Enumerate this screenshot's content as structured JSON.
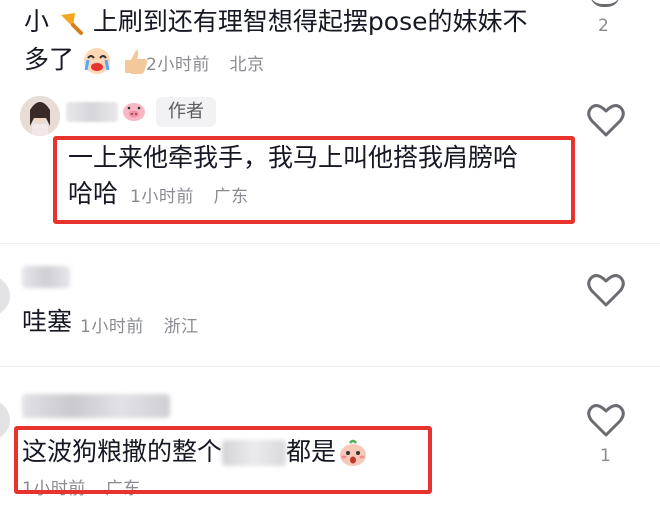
{
  "comments": [
    {
      "text_a": "小",
      "text_b": "上刷到还有理智想得起摆pose的妹妹不",
      "text_line2": "多了",
      "time": "2小时前",
      "location": "北京",
      "likes": "2"
    },
    {
      "author_tag": "作者",
      "text_line1": "一上来他牵我手，我马上叫他搭我肩膀哈",
      "text_line2": "哈哈",
      "time": "1小时前",
      "location": "广东"
    },
    {
      "text": "哇塞",
      "time": "1小时前",
      "location": "浙江"
    },
    {
      "text_a": "这波狗粮撒的整个",
      "text_b": "都是",
      "time": "1小时前",
      "location": "广东",
      "likes": "1"
    }
  ],
  "colors": {
    "highlight_box": "#e8322e",
    "text": "#161823",
    "meta": "#8a8b91",
    "heart_stroke": "#6b6c72"
  },
  "icons": [
    "heart-outline-icon",
    "crying-emoji-icon",
    "thumbs-up-emoji-icon",
    "pig-emoji-icon",
    "shy-face-emoji-icon",
    "shovel-emoji-icon"
  ]
}
